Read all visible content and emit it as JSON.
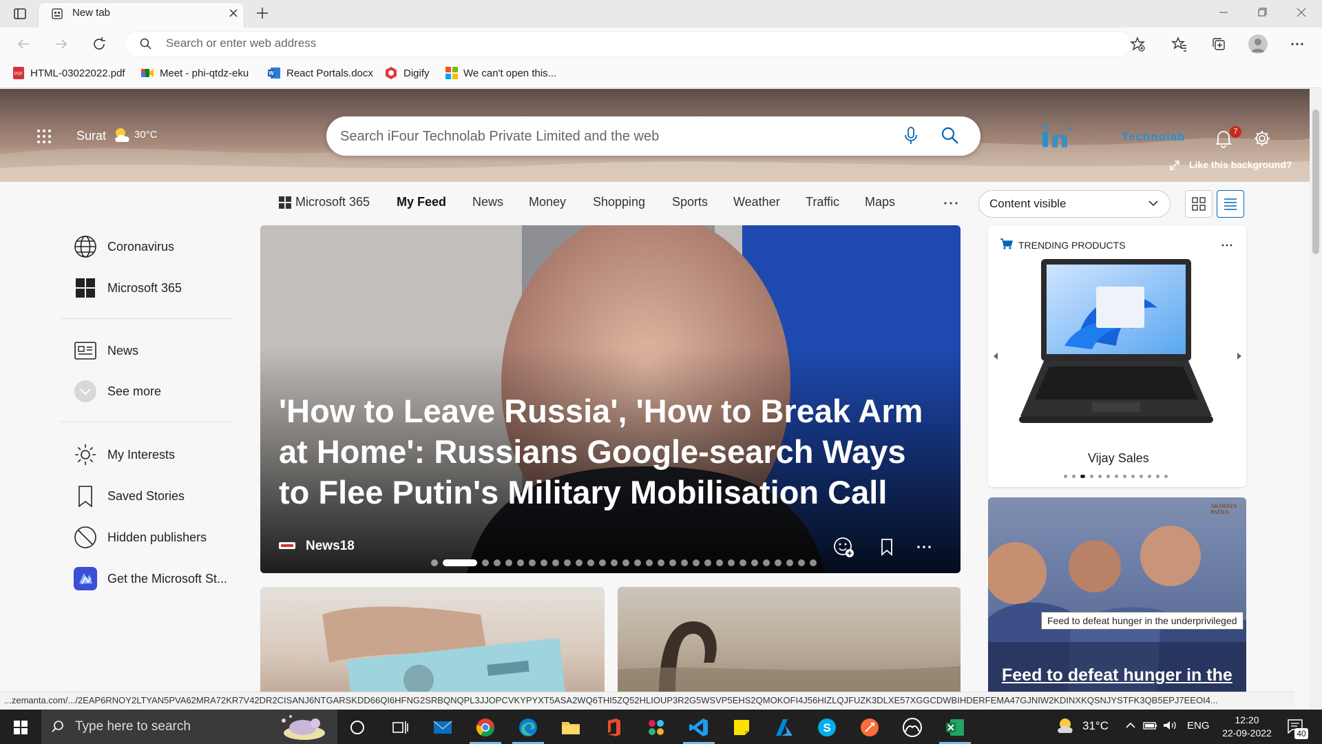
{
  "browser": {
    "tab_title": "New tab",
    "address_placeholder": "Search or enter web address",
    "bookmarks": [
      {
        "label": "HTML-03022022.pdf",
        "icon": "pdf-icon"
      },
      {
        "label": "Meet - phi-qtdz-eku",
        "icon": "meet-icon"
      },
      {
        "label": "React Portals.docx",
        "icon": "word-icon"
      },
      {
        "label": "Digify",
        "icon": "digify-icon"
      },
      {
        "label": "We can't open this...",
        "icon": "microsoft-icon"
      }
    ]
  },
  "header": {
    "city": "Surat",
    "temperature": "30°C",
    "search_placeholder": "Search iFour Technolab Private Limited and the web",
    "company_logo_text": "Technolab",
    "notification_count": "7",
    "background_prompt": "Like this background?"
  },
  "nav": {
    "items": [
      "Microsoft 365",
      "My Feed",
      "News",
      "Money",
      "Shopping",
      "Sports",
      "Weather",
      "Traffic",
      "Maps"
    ],
    "active": "My Feed",
    "content_select": "Content visible"
  },
  "sidebar": {
    "items": [
      {
        "label": "Coronavirus",
        "icon": "globe-icon"
      },
      {
        "label": "Microsoft 365",
        "icon": "windows-icon"
      },
      {
        "label": "News",
        "icon": "newspaper-icon"
      },
      {
        "label": "See more",
        "icon": "chevron-down-icon"
      },
      {
        "label": "My Interests",
        "icon": "sun-icon"
      },
      {
        "label": "Saved Stories",
        "icon": "bookmark-icon"
      },
      {
        "label": "Hidden publishers",
        "icon": "block-icon"
      },
      {
        "label": "Get the Microsoft St...",
        "icon": "microsoft-start-icon"
      }
    ]
  },
  "hero": {
    "title": "'How to Leave Russia', 'How to Break Arm at Home': Russians Google-search Ways to Flee Putin's Military Mobilisation Call",
    "source": "News18",
    "carousel_total": 31,
    "carousel_active": 2
  },
  "trending": {
    "heading": "TRENDING PRODUCTS",
    "store": "Vijay Sales",
    "dots_total": 13,
    "dots_active": 3
  },
  "feed_card": {
    "tooltip": "Feed to defeat hunger in the underprivileged",
    "title": "Feed to defeat hunger in the",
    "badge": "AKSHAYA PATRA"
  },
  "status_url": "...zemanta.com/.../2EAP6RNOY2LTYAN5PVA62MRA72KR7V42DR2CISANJ6NTGARSKDD66QI6HFNG2SRBQNQPL3JJOPCVKYPYXT5ASA2WQ6THI5ZQ52HLIOUP3R2G5WSVP5EHS2QMOKOFI4J56HIZLQJFUZK3DLXE57XGGCDWBIHDERFEMA47GJNIW2KDINXKQSNJYSTFK3QB5EPJ7EEOI4...",
  "taskbar": {
    "search_placeholder": "Type here to search",
    "weather": "31°C",
    "language": "ENG",
    "time": "12:20",
    "date": "22-09-2022",
    "notifications": "40"
  },
  "colors": {
    "accent": "#0067b8",
    "taskbar": "#202020",
    "notification_badge": "#c42b1c"
  }
}
